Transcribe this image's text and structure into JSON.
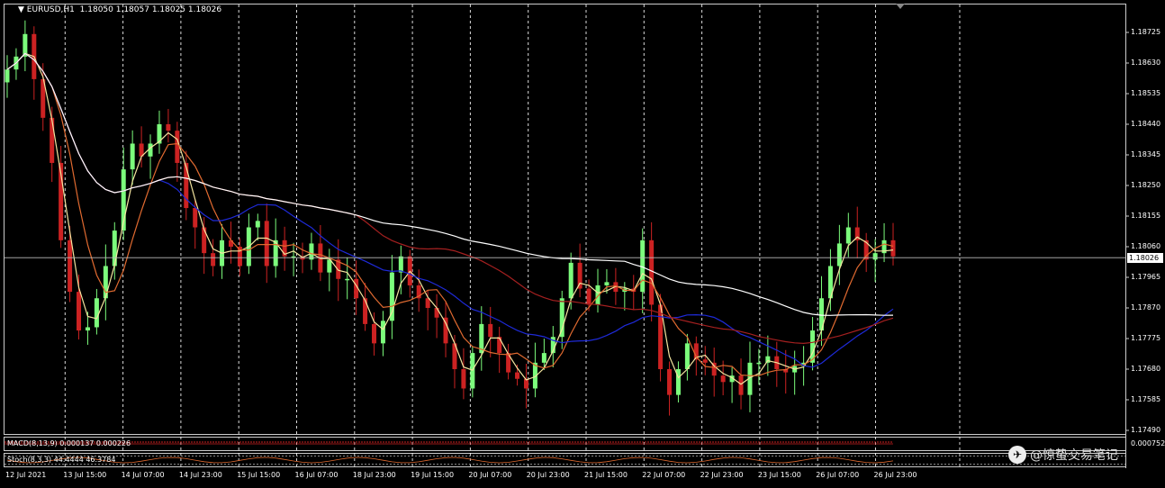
{
  "header": {
    "symbol_label": "EURUSD,H1",
    "ohlc": "1.18050 1.18057 1.18025 1.18026"
  },
  "price_axis": {
    "labels": [
      "1.18725",
      "1.18630",
      "1.18535",
      "1.18440",
      "1.18345",
      "1.18250",
      "1.18155",
      "1.18060",
      "1.17965",
      "1.17870",
      "1.17775",
      "1.17680",
      "1.17585",
      "1.17490"
    ],
    "current_price": "1.18026"
  },
  "time_axis": {
    "labels": [
      "12 Jul 2021",
      "13 Jul 15:00",
      "14 Jul 07:00",
      "14 Jul 23:00",
      "15 Jul 15:00",
      "16 Jul 07:00",
      "18 Jul 23:00",
      "19 Jul 15:00",
      "20 Jul 07:00",
      "20 Jul 23:00",
      "21 Jul 15:00",
      "22 Jul 07:00",
      "22 Jul 23:00",
      "23 Jul 15:00",
      "26 Jul 07:00",
      "26 Jul 23:00"
    ]
  },
  "indicators": {
    "macd_label": "MACD(8,13,9) 0.000137 0.000226",
    "macd_scale": "0.000752",
    "stoch_label": "Stoch(8,3,3) 44.4444 46.3784"
  },
  "watermark": {
    "text": "@惊蛰交易笔记"
  },
  "colors": {
    "background": "#000000",
    "bull_candle": "#7CFC7C",
    "bear_candle": "#CC2222",
    "grid": "#FFFFFF",
    "ma_white": "#FFFFFF",
    "ma_blue": "#1E2AD8",
    "ma_red": "#A52020",
    "ma_yellow": "#F5E6A0",
    "ma_orange": "#E06A30"
  },
  "chart_data": {
    "type": "candlestick",
    "ylim": [
      1.1749,
      1.18725
    ],
    "closes": [
      1.1861,
      1.1865,
      1.1872,
      1.1858,
      1.1846,
      1.1832,
      1.1808,
      1.1792,
      1.178,
      1.1781,
      1.179,
      1.18,
      1.1811,
      1.183,
      1.1838,
      1.1834,
      1.1838,
      1.1844,
      1.1842,
      1.1832,
      1.1818,
      1.1812,
      1.1804,
      1.18,
      1.1808,
      1.1806,
      1.18,
      1.1812,
      1.1814,
      1.18,
      1.1808,
      1.1803,
      1.1803,
      1.1802,
      1.1807,
      1.1798,
      1.1802,
      1.1796,
      1.1796,
      1.179,
      1.1782,
      1.1776,
      1.1783,
      1.1798,
      1.1803,
      1.1794,
      1.179,
      1.1787,
      1.1784,
      1.1776,
      1.1768,
      1.1762,
      1.1773,
      1.1782,
      1.1778,
      1.1773,
      1.1767,
      1.1765,
      1.1762,
      1.177,
      1.1773,
      1.1778,
      1.179,
      1.1801,
      1.1793,
      1.1788,
      1.1794,
      1.1795,
      1.1792,
      1.1793,
      1.1792,
      1.1808,
      1.1788,
      1.1768,
      1.176,
      1.1768,
      1.1776,
      1.1771,
      1.177,
      1.1766,
      1.1764,
      1.1766,
      1.176,
      1.177,
      1.177,
      1.1772,
      1.1768,
      1.1767,
      1.1769,
      1.177,
      1.178,
      1.179,
      1.18,
      1.1807,
      1.1812,
      1.1808,
      1.1802,
      1.1804,
      1.1808,
      1.1803
    ]
  }
}
